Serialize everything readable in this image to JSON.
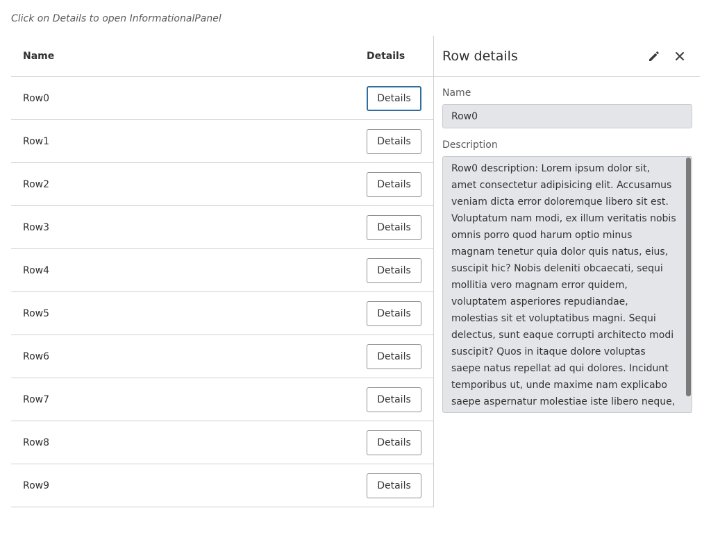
{
  "hint": "Click on Details to open InformationalPanel",
  "table": {
    "headers": {
      "name": "Name",
      "details": "Details"
    },
    "rows": [
      {
        "name": "Row0",
        "button": "Details"
      },
      {
        "name": "Row1",
        "button": "Details"
      },
      {
        "name": "Row2",
        "button": "Details"
      },
      {
        "name": "Row3",
        "button": "Details"
      },
      {
        "name": "Row4",
        "button": "Details"
      },
      {
        "name": "Row5",
        "button": "Details"
      },
      {
        "name": "Row6",
        "button": "Details"
      },
      {
        "name": "Row7",
        "button": "Details"
      },
      {
        "name": "Row8",
        "button": "Details"
      },
      {
        "name": "Row9",
        "button": "Details"
      }
    ],
    "active_row": 0
  },
  "panel": {
    "title": "Row details",
    "icons": {
      "edit": "pencil-icon",
      "close": "close-icon"
    },
    "name_label": "Name",
    "name_value": "Row0",
    "description_label": "Description",
    "description_value": "Row0 description: Lorem ipsum dolor sit, amet consectetur adipisicing elit. Accusamus veniam dicta error doloremque libero sit est. Voluptatum nam modi, ex illum veritatis nobis omnis porro quod harum optio minus magnam tenetur quia dolor quis natus, eius, suscipit hic? Nobis deleniti obcaecati, sequi mollitia vero magnam error quidem, voluptatem asperiores repudiandae, molestias sit et voluptatibus magni. Sequi delectus, sunt eaque corrupti architecto modi suscipit? Quos in itaque dolore voluptas saepe natus repellat ad qui dolores. Incidunt temporibus ut, unde maxime nam explicabo saepe aspernatur molestiae iste libero neque, alias corporis laboriosam fugiat ad. Dicta neque"
  },
  "colors": {
    "focus_border": "#2f6e9e",
    "field_background": "#e3e5e8",
    "divider": "#cfcfcf"
  }
}
